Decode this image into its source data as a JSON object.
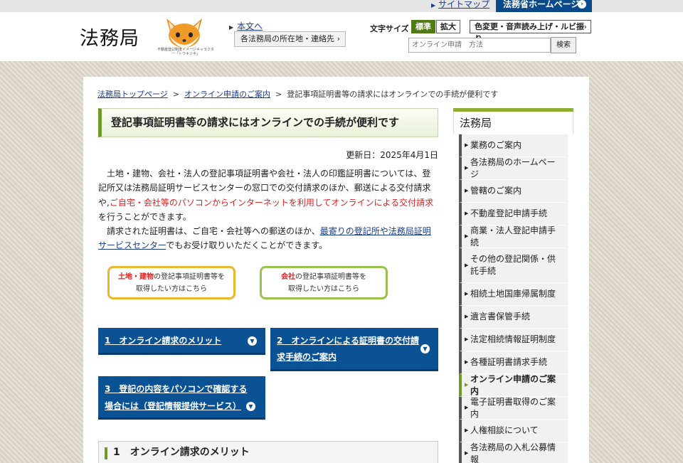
{
  "top": {
    "sitemap": "サイトマップ",
    "moj_home": "法務省ホームページ"
  },
  "header": {
    "logo": "法務局",
    "fox_caption": "不動産登記制度イメージキャラクター「トウキツネ」",
    "honbun": "本文へ",
    "locations_button": "各法務局の所在地・連絡先",
    "font_size_label": "文字サイズ",
    "font_standard": "標準",
    "font_large": "拡大",
    "color_button": "色変更・音声読み上げ・ルビ振り",
    "search_placeholder": "オンライン申請　方法",
    "search_button": "検索"
  },
  "breadcrumb": {
    "home": "法務局トップページ",
    "online": "オンライン申請のご案内",
    "current": "登記事項証明書等の請求にはオンラインでの手続が便利です"
  },
  "main": {
    "title": "登記事項証明書等の請求にはオンラインでの手続が便利です",
    "updated": "更新日：2025年4月1日",
    "para1_a": "土地・建物、会社・法人の登記事項証明書や会社・法人の印鑑証明書については、登記所又は法務局証明サービスセンターの窓口での交付請求のほか、郵送による交付請求や,",
    "para1_red": "ご自宅・会社等のパソコンからインターネットを利用してオンラインによる交付請求",
    "para1_b": "を行うことができます。",
    "para2_a": "請求された証明書は、ご自宅・会社等への郵送のほか、",
    "para2_link": "最寄りの登記所や法務局証明サービスセンター",
    "para2_b": "でもお受け取りいただくことができます。",
    "land_hl": "土地・建物",
    "land_rest": "の登記事項証明書等を",
    "land_line2": "取得したい方はこちら",
    "company_hl": "会社",
    "company_rest": "の登記事項証明書等を",
    "company_line2": "取得したい方はこちら",
    "acc1": "1　オンライン請求のメリット",
    "acc2_l1": "2　オンラインによる証明書の交付請",
    "acc2_l2": "求手続のご案内",
    "acc3_l1": "3　登記の内容をパソコンで確認する",
    "acc3_l2": "場合には（登記情報提供サービス）",
    "section1": "1　オンライン請求のメリット"
  },
  "sidebar": {
    "title": "法務局",
    "items": [
      "業務のご案内",
      "各法務局のホームページ",
      "管轄のご案内",
      "不動産登記申請手続",
      "商業・法人登記申請手続",
      "その他の登記関係・供託手続",
      "相続土地国庫帰属制度",
      "遺言書保管手続",
      "法定相続情報証明制度",
      "各種証明書請求手続",
      "オンライン申請のご案内",
      "電子証明書取得のご案内",
      "人権相談について",
      "各法務局の入札公募情報"
    ],
    "active_index": 10
  },
  "colors": {
    "accent_green": "#6f9a2a",
    "nav_blue": "#0b5294",
    "link_red": "#dd2222"
  }
}
